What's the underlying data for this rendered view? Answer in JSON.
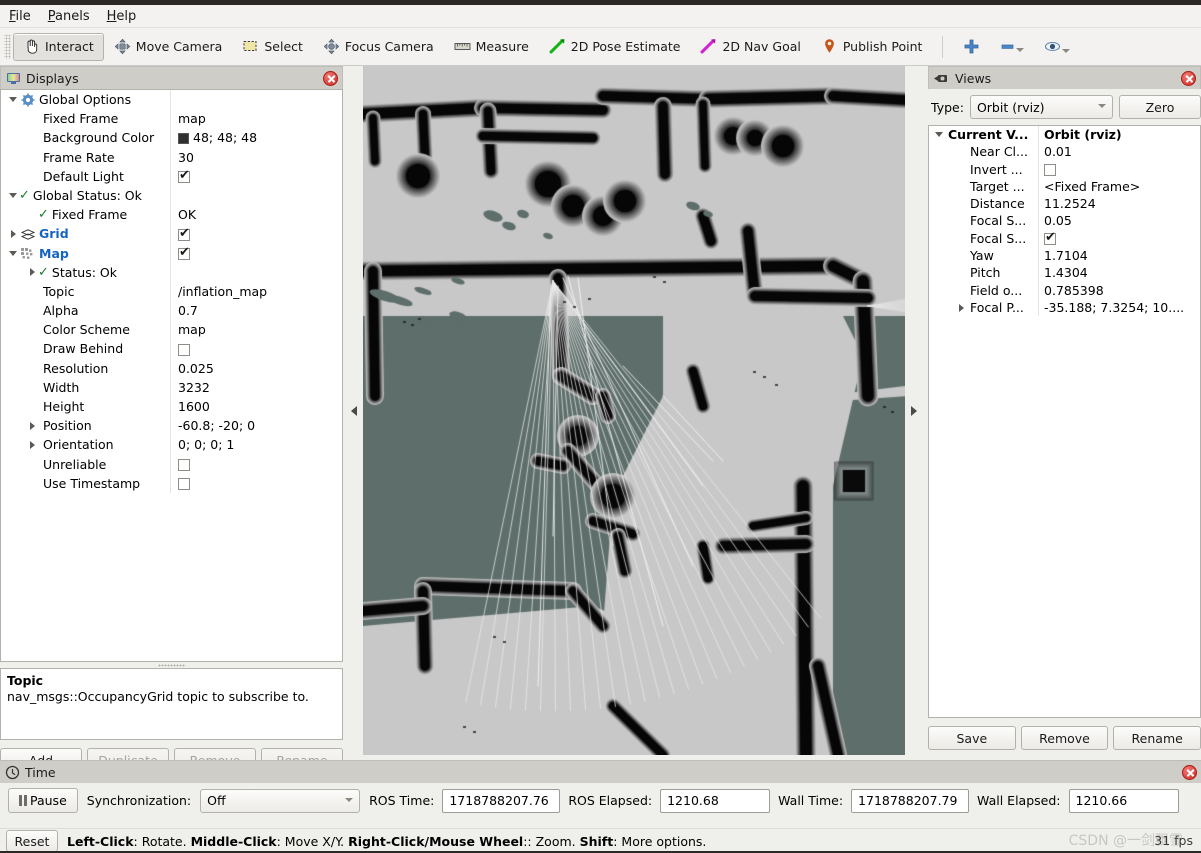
{
  "menu": {
    "items": [
      {
        "label": "File",
        "mnemonic": "F"
      },
      {
        "label": "Panels",
        "mnemonic": "P"
      },
      {
        "label": "Help",
        "mnemonic": "H"
      }
    ]
  },
  "toolbar": {
    "buttons": [
      {
        "label": "Interact",
        "icon": "hand-cursor-icon",
        "active": true
      },
      {
        "label": "Move Camera",
        "icon": "move-camera-icon",
        "active": false
      },
      {
        "label": "Select",
        "icon": "select-rect-icon",
        "active": false
      },
      {
        "label": "Focus Camera",
        "icon": "focus-camera-icon",
        "active": false
      },
      {
        "label": "Measure",
        "icon": "ruler-icon",
        "active": false
      },
      {
        "label": "2D Pose Estimate",
        "icon": "green-arrow-icon",
        "active": false
      },
      {
        "label": "2D Nav Goal",
        "icon": "magenta-arrow-icon",
        "active": false
      },
      {
        "label": "Publish Point",
        "icon": "map-pin-icon",
        "active": false
      }
    ],
    "add_tool_label": "+",
    "remove_tool_label": "−",
    "visibility_label": "◉",
    "accent": "#3e7dc0"
  },
  "displays": {
    "title": "Displays",
    "rows": [
      {
        "indent": 0,
        "arrow": "down",
        "icon": "gear-icon",
        "name": "Global Options",
        "value": "",
        "style": "bold",
        "value_kind": "text"
      },
      {
        "indent": 1,
        "arrow": "none",
        "icon": "",
        "name": "Fixed Frame",
        "value": "map",
        "value_kind": "text"
      },
      {
        "indent": 1,
        "arrow": "none",
        "icon": "",
        "name": "Background Color",
        "value": "48; 48; 48",
        "value_kind": "color",
        "color": "#303030"
      },
      {
        "indent": 1,
        "arrow": "none",
        "icon": "",
        "name": "Frame Rate",
        "value": "30",
        "value_kind": "text"
      },
      {
        "indent": 1,
        "arrow": "none",
        "icon": "",
        "name": "Default Light",
        "value": "",
        "value_kind": "checkbox",
        "checked": true
      },
      {
        "indent": 0,
        "arrow": "down",
        "icon": "check-icon",
        "name": "Global Status: Ok",
        "value": "",
        "style": "bold",
        "value_kind": "text"
      },
      {
        "indent": 1,
        "arrow": "none",
        "icon": "check-icon",
        "name": "Fixed Frame",
        "value": "OK",
        "value_kind": "text"
      },
      {
        "indent": 0,
        "arrow": "right",
        "icon": "grid-icon",
        "name": "Grid",
        "value": "",
        "style": "blue",
        "value_kind": "checkbox",
        "checked": true
      },
      {
        "indent": 0,
        "arrow": "down",
        "icon": "map-icon",
        "name": "Map",
        "value": "",
        "style": "blue",
        "value_kind": "checkbox",
        "checked": true
      },
      {
        "indent": 1,
        "arrow": "right",
        "icon": "check-icon",
        "name": "Status: Ok",
        "value": "",
        "value_kind": "text"
      },
      {
        "indent": 1,
        "arrow": "none",
        "icon": "",
        "name": "Topic",
        "value": "/inflation_map",
        "value_kind": "text"
      },
      {
        "indent": 1,
        "arrow": "none",
        "icon": "",
        "name": "Alpha",
        "value": "0.7",
        "value_kind": "text"
      },
      {
        "indent": 1,
        "arrow": "none",
        "icon": "",
        "name": "Color Scheme",
        "value": "map",
        "value_kind": "text"
      },
      {
        "indent": 1,
        "arrow": "none",
        "icon": "",
        "name": "Draw Behind",
        "value": "",
        "value_kind": "checkbox",
        "checked": false
      },
      {
        "indent": 1,
        "arrow": "none",
        "icon": "",
        "name": "Resolution",
        "value": "0.025",
        "value_kind": "text"
      },
      {
        "indent": 1,
        "arrow": "none",
        "icon": "",
        "name": "Width",
        "value": "3232",
        "value_kind": "text"
      },
      {
        "indent": 1,
        "arrow": "none",
        "icon": "",
        "name": "Height",
        "value": "1600",
        "value_kind": "text"
      },
      {
        "indent": 1,
        "arrow": "right",
        "icon": "",
        "name": "Position",
        "value": "-60.8; -20; 0",
        "value_kind": "text"
      },
      {
        "indent": 1,
        "arrow": "right",
        "icon": "",
        "name": "Orientation",
        "value": "0; 0; 0; 1",
        "value_kind": "text"
      },
      {
        "indent": 1,
        "arrow": "none",
        "icon": "",
        "name": "Unreliable",
        "value": "",
        "value_kind": "checkbox",
        "checked": false
      },
      {
        "indent": 1,
        "arrow": "none",
        "icon": "",
        "name": "Use Timestamp",
        "value": "",
        "value_kind": "checkbox",
        "checked": false
      }
    ],
    "description": {
      "heading": "Topic",
      "text": "nav_msgs::OccupancyGrid topic to subscribe to."
    },
    "buttons": [
      {
        "label": "Add",
        "enabled": true
      },
      {
        "label": "Duplicate",
        "enabled": false
      },
      {
        "label": "Remove",
        "enabled": false
      },
      {
        "label": "Rename",
        "enabled": false
      }
    ]
  },
  "views": {
    "title": "Views",
    "type_label": "Type:",
    "type_value": "Orbit (rviz)",
    "zero_label": "Zero",
    "rows": [
      {
        "indent": 0,
        "arrow": "down",
        "name": "Current V...",
        "value": "Orbit (rviz)",
        "bold": true,
        "value_kind": "text"
      },
      {
        "indent": 1,
        "arrow": "none",
        "name": "Near Cl...",
        "value": "0.01",
        "value_kind": "text"
      },
      {
        "indent": 1,
        "arrow": "none",
        "name": "Invert ...",
        "value": "",
        "value_kind": "checkbox",
        "checked": false
      },
      {
        "indent": 1,
        "arrow": "none",
        "name": "Target ...",
        "value": "<Fixed Frame>",
        "value_kind": "text"
      },
      {
        "indent": 1,
        "arrow": "none",
        "name": "Distance",
        "value": "11.2524",
        "value_kind": "text"
      },
      {
        "indent": 1,
        "arrow": "none",
        "name": "Focal S...",
        "value": "0.05",
        "value_kind": "text"
      },
      {
        "indent": 1,
        "arrow": "none",
        "name": "Focal S...",
        "value": "",
        "value_kind": "checkbox",
        "checked": true
      },
      {
        "indent": 1,
        "arrow": "none",
        "name": "Yaw",
        "value": "1.7104",
        "value_kind": "text"
      },
      {
        "indent": 1,
        "arrow": "none",
        "name": "Pitch",
        "value": "1.4304",
        "value_kind": "text"
      },
      {
        "indent": 1,
        "arrow": "none",
        "name": "Field o...",
        "value": "0.785398",
        "value_kind": "text"
      },
      {
        "indent": 1,
        "arrow": "right",
        "name": "Focal P...",
        "value": "-35.188; 7.3254; 10....",
        "value_kind": "text"
      }
    ],
    "buttons": [
      {
        "label": "Save"
      },
      {
        "label": "Remove"
      },
      {
        "label": "Rename"
      }
    ]
  },
  "render": {
    "background_color": "#5d6e6b",
    "free_space_color": "#c8c8c8",
    "obstacle_color": "#050505"
  },
  "time": {
    "title": "Time",
    "pause_label": "Pause",
    "sync_label": "Synchronization:",
    "sync_value": "Off",
    "fields": [
      {
        "label": "ROS Time:",
        "value": "1718788207.76"
      },
      {
        "label": "ROS Elapsed:",
        "value": "1210.68"
      },
      {
        "label": "Wall Time:",
        "value": "1718788207.79"
      },
      {
        "label": "Wall Elapsed:",
        "value": "1210.66"
      }
    ]
  },
  "status": {
    "reset_label": "Reset",
    "hint_parts": [
      {
        "text": "Left-Click",
        "bold": true
      },
      {
        "text": ": Rotate. ",
        "bold": false
      },
      {
        "text": "Middle-Click",
        "bold": true
      },
      {
        "text": ": Move X/Y. ",
        "bold": false
      },
      {
        "text": "Right-Click/Mouse Wheel",
        "bold": true
      },
      {
        "text": ":: Zoom. ",
        "bold": false
      },
      {
        "text": "Shift",
        "bold": true
      },
      {
        "text": ": More options.",
        "bold": false
      }
    ],
    "fps": "31 fps",
    "watermark": "CSDN @一剑飘雪"
  }
}
